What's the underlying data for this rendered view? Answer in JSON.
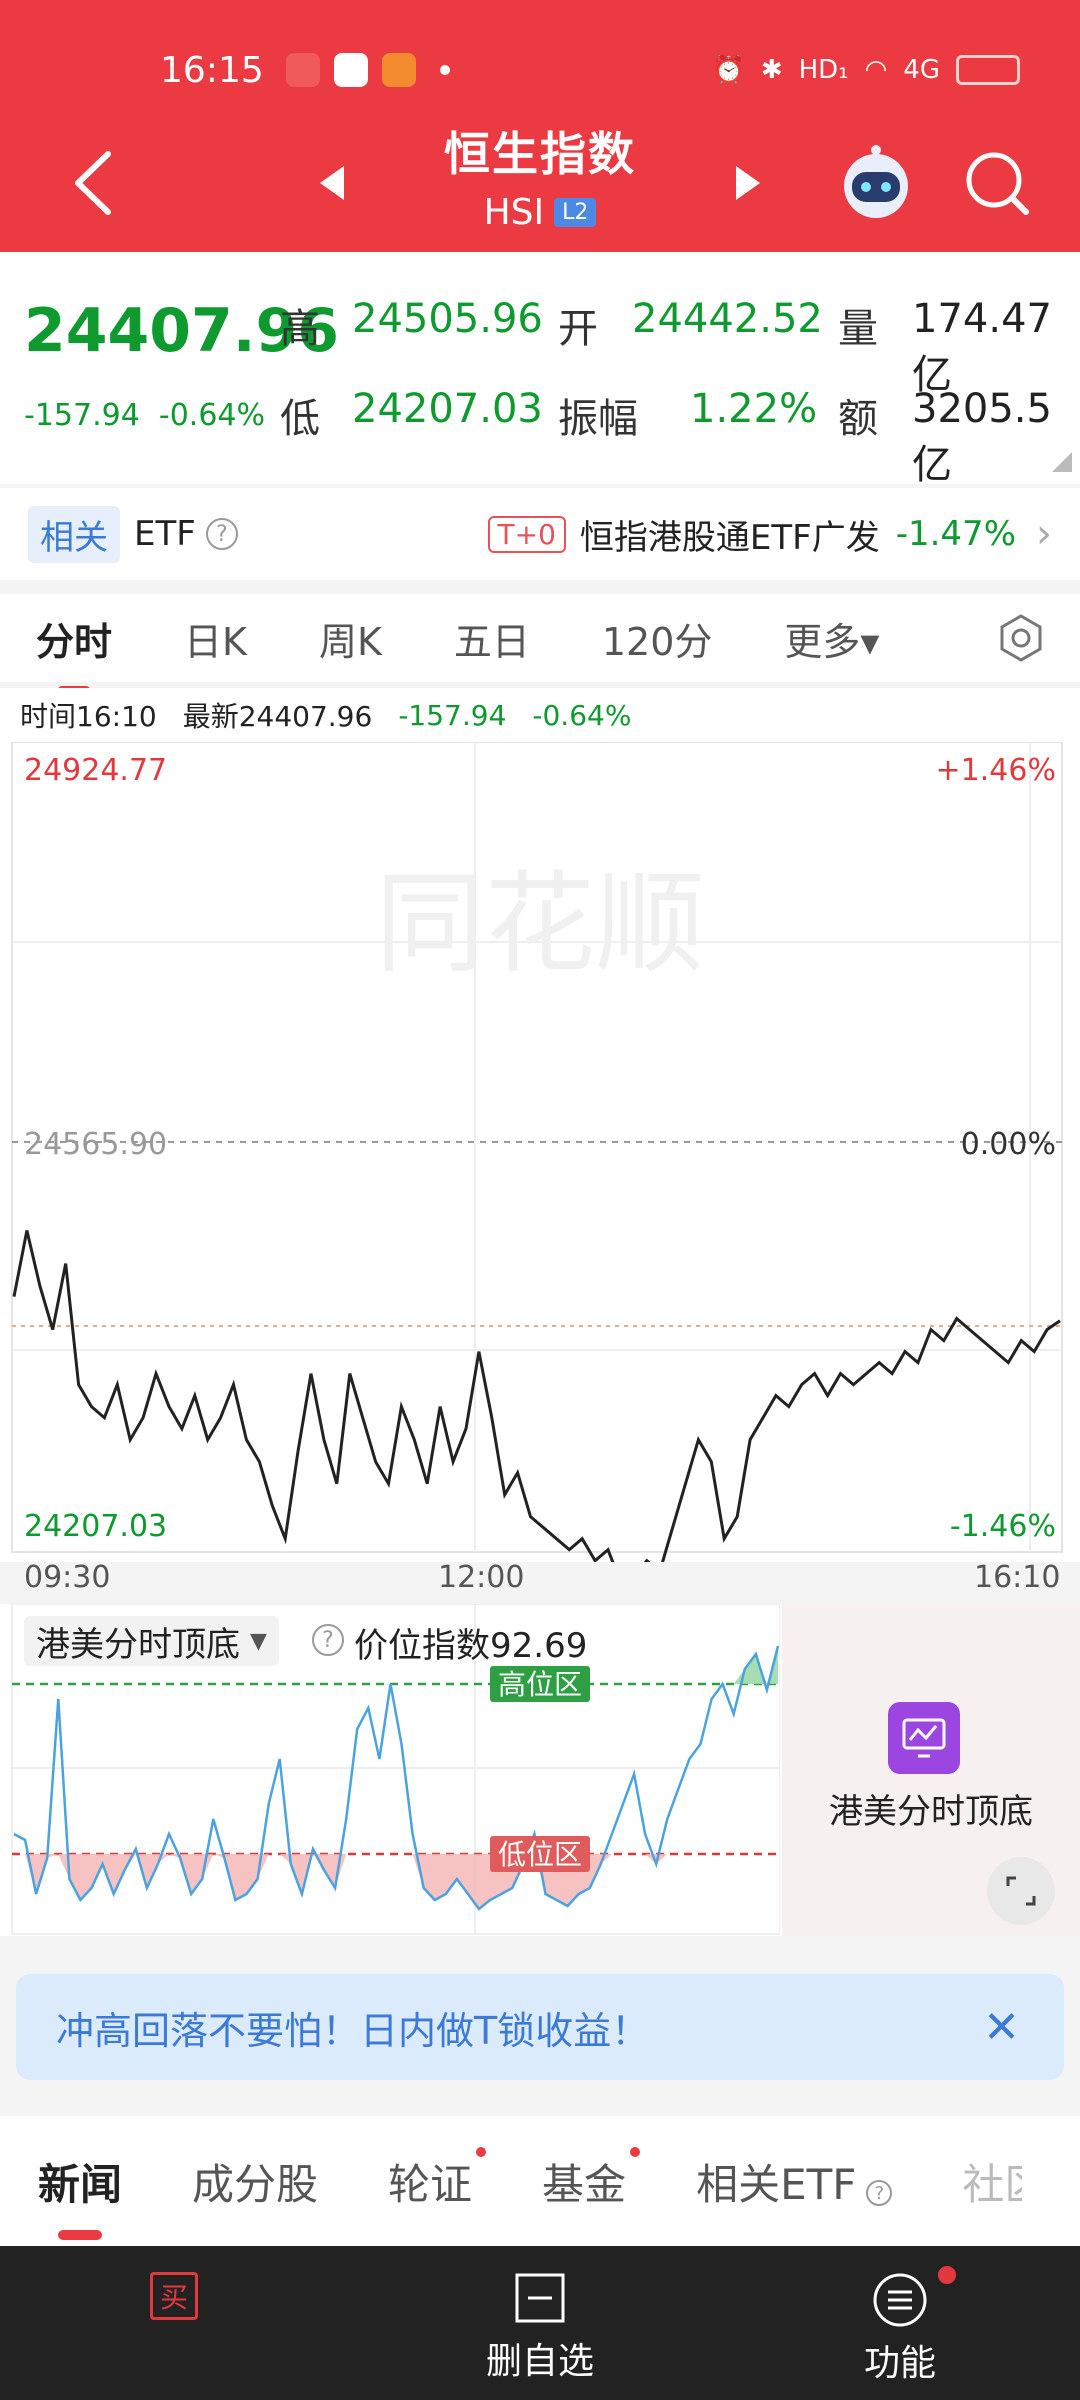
{
  "status_bar": {
    "time": "16:15",
    "icons": [
      "play-icon",
      "app-icon",
      "book-icon",
      "news-icon",
      "alarm-icon",
      "bluetooth-icon",
      "hd-icon",
      "wifi-icon",
      "signal-icon",
      "battery-icon"
    ],
    "hd": "HD₁",
    "net": "4G"
  },
  "header": {
    "title": "恒生指数",
    "code": "HSI",
    "badge": "L2"
  },
  "quote": {
    "price": "24407.96",
    "change": "-157.94",
    "change_pct": "-0.64%",
    "high_label": "高",
    "high": "24505.96",
    "open_label": "开",
    "open": "24442.52",
    "volume_label": "量",
    "volume": "174.47亿",
    "low_label": "低",
    "low": "24207.03",
    "amplitude_label": "振幅",
    "amplitude": "1.22%",
    "amount_label": "额",
    "amount": "3205.5亿"
  },
  "etf": {
    "tag": "相关",
    "label": "ETF",
    "t0": "T+0",
    "name": "恒指港股通ETF广发",
    "pct": "-1.47%"
  },
  "tabs": [
    "分时",
    "日K",
    "周K",
    "五日",
    "120分",
    "更多▾"
  ],
  "info": {
    "time": "时间16:10",
    "latest": "最新24407.96",
    "chg": "-157.94",
    "pct": "-0.64%"
  },
  "chart_data": {
    "type": "line",
    "title": "",
    "x_labels": [
      "09:30",
      "12:00",
      "16:10"
    ],
    "y_max": "24924.77",
    "y_ref": "24565.90",
    "y_min": "24207.03",
    "pct_max": "+1.46%",
    "pct_ref": "0.00%",
    "pct_min": "-1.46%",
    "ylim": [
      24207.03,
      24924.77
    ],
    "watermark": "同花顺",
    "series": [
      {
        "values": [
          24430,
          24490,
          24440,
          24400,
          24460,
          24350,
          24330,
          24320,
          24350,
          24300,
          24320,
          24360,
          24330,
          24310,
          24340,
          24300,
          24320,
          24350,
          24300,
          24280,
          24240,
          24210,
          24290,
          24360,
          24300,
          24260,
          24360,
          24320,
          24280,
          24260,
          24330,
          24300,
          24260,
          24330,
          24280,
          24310,
          24380,
          24320,
          24250,
          24270,
          24230,
          24220,
          24210,
          24200,
          24210,
          24190,
          24200,
          24170,
          24175,
          24190,
          24180,
          24220,
          24260,
          24300,
          24280,
          24210,
          24230,
          24300,
          24320,
          24340,
          24330,
          24350,
          24360,
          24340,
          24360,
          24350,
          24360,
          24370,
          24360,
          24380,
          24370,
          24400,
          24390,
          24410,
          24400,
          24390,
          24380,
          24370,
          24390,
          24380,
          24400,
          24407.96
        ]
      }
    ]
  },
  "indicator": {
    "name": "港美分时顶底",
    "label": "价位指数92.69",
    "high_zone": "高位区",
    "low_zone": "低位区",
    "panel_title": "港美分时顶底",
    "series": [
      30,
      28,
      10,
      22,
      75,
      15,
      8,
      12,
      20,
      10,
      18,
      25,
      12,
      20,
      30,
      22,
      10,
      15,
      35,
      22,
      8,
      10,
      15,
      40,
      55,
      20,
      10,
      25,
      18,
      12,
      35,
      65,
      72,
      55,
      80,
      60,
      30,
      12,
      8,
      10,
      15,
      10,
      5,
      8,
      10,
      12,
      20,
      30,
      10,
      8,
      6,
      10,
      12,
      20,
      30,
      40,
      50,
      30,
      20,
      35,
      45,
      55,
      60,
      75,
      80,
      70,
      85,
      90,
      78,
      92.69
    ]
  },
  "banner": {
    "text": "冲高回落不要怕！日内做T锁收益！"
  },
  "news_tabs": [
    "新闻",
    "成分股",
    "轮证",
    "基金",
    "相关ETF",
    "社区"
  ],
  "bottom_bar": {
    "buy": "买",
    "watch": "删自选",
    "func": "功能"
  }
}
